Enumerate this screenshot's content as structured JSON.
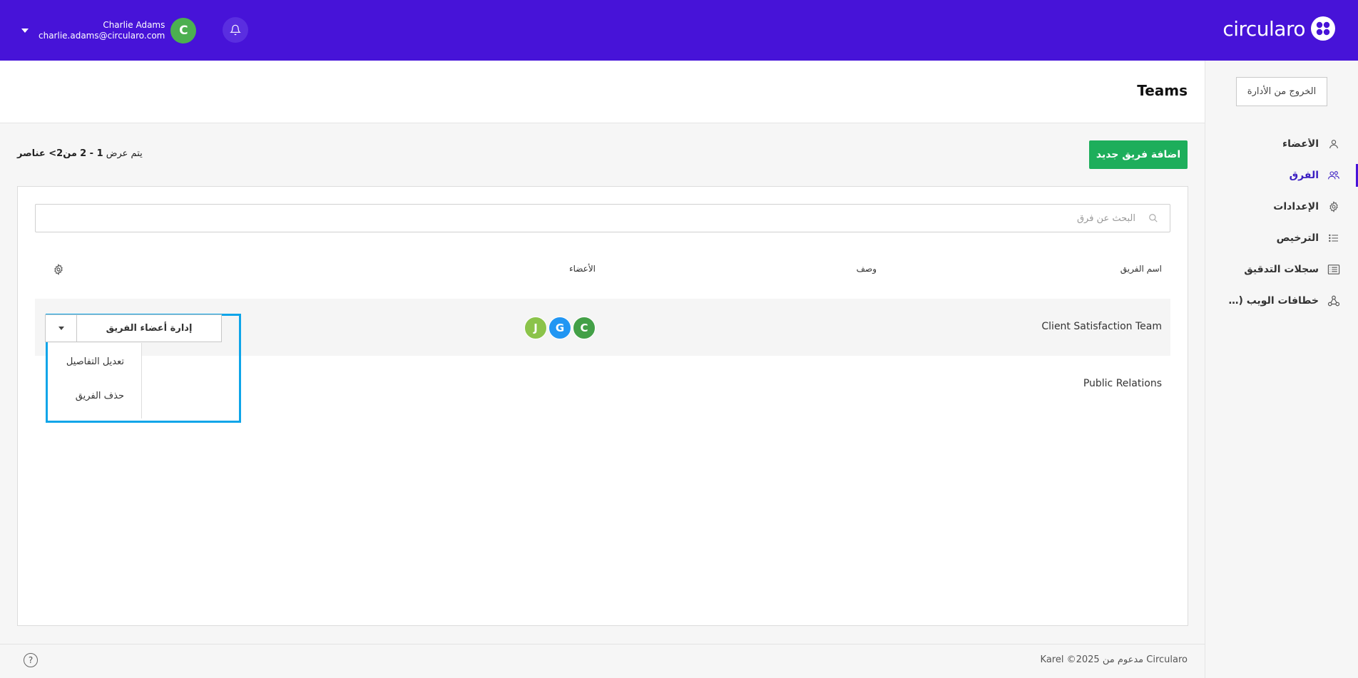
{
  "app": {
    "logo_text": "circularo",
    "colors": {
      "brand": "#4713d8",
      "accent_green": "#1dae5b",
      "highlight": "#0ea5e9"
    }
  },
  "header": {
    "user_name": "Charlie Adams",
    "user_email": "charlie.adams@circularo.com",
    "user_initial": "C",
    "bell_icon": "bell-icon"
  },
  "sidebar": {
    "logout_label": "الخروج من الأدارة",
    "items": [
      {
        "label": "الأعضاء",
        "icon": "user-icon"
      },
      {
        "label": "الفرق",
        "icon": "users-icon"
      },
      {
        "label": "الإعدادات",
        "icon": "gear-icon"
      },
      {
        "label": "الترخيص",
        "icon": "list-icon"
      },
      {
        "label": "سجلات التدقيق",
        "icon": "log-icon"
      },
      {
        "label": "خطافات الويب (Webhooks)",
        "icon": "webhook-icon"
      }
    ]
  },
  "page": {
    "title": "Teams",
    "add_team_label": "اضافة فريق جديد",
    "showing_prefix": "يتم عرض",
    "showing_range": "1 - 2",
    "showing_of": "من",
    "showing_total": "2",
    "showing_suffix": "> عناصر"
  },
  "table": {
    "search_placeholder": "البحث عن فرق",
    "columns": {
      "name": "اسم الفريق",
      "description": "وصف",
      "members": "الأعضاء"
    },
    "rows": [
      {
        "name": "Client Satisfaction Team",
        "members": [
          {
            "initial": "C",
            "color": "#43a047"
          },
          {
            "initial": "G",
            "color": "#2196f3"
          },
          {
            "initial": "J",
            "color": "#8bc34a"
          }
        ]
      },
      {
        "name": "Public Relations",
        "members": []
      }
    ]
  },
  "actions": {
    "manage_label": "إدارة أعضاء الفريق",
    "menu": [
      "تعديل التفاصيل",
      "حذف الفريق"
    ]
  },
  "footer": {
    "text": "Karel ©2025 مدعوم من Circularo",
    "help": "?"
  }
}
